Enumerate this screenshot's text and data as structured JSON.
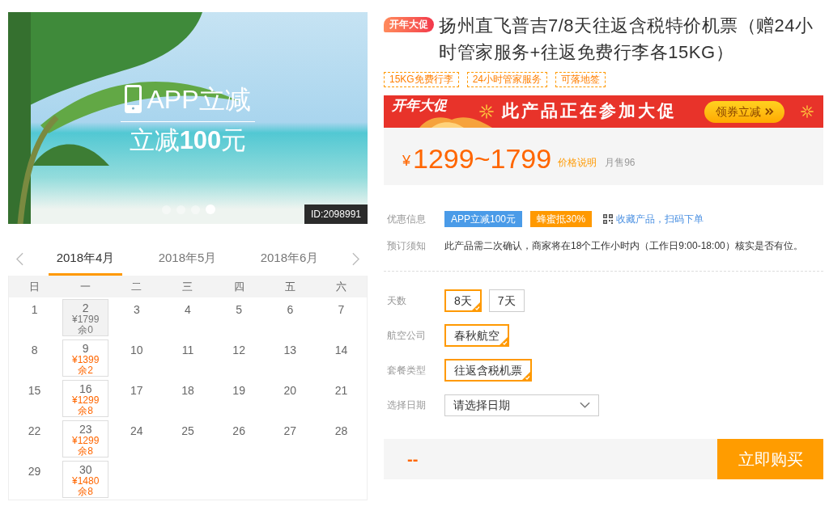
{
  "gallery": {
    "overlay": {
      "title": "APP立减",
      "subtitle": "立减**100**元"
    },
    "slides": [
      {
        "selected": false
      },
      {
        "selected": false
      },
      {
        "selected": false
      },
      {
        "selected": true
      }
    ],
    "id_badge": "ID:2098991"
  },
  "calendar": {
    "months": [
      {
        "label": "2018年4月",
        "selected": true
      },
      {
        "label": "2018年5月",
        "selected": false
      },
      {
        "label": "2018年6月",
        "selected": false
      }
    ],
    "weekdays": [
      "日",
      "一",
      "二",
      "三",
      "四",
      "五",
      "六"
    ],
    "weeks": [
      {
        "days": [
          {
            "kind": "plain",
            "day": "1"
          },
          {
            "kind": "priced",
            "day": "2",
            "price": "¥1799",
            "stock": "余0",
            "available": false
          },
          {
            "kind": "plain",
            "day": "3"
          },
          {
            "kind": "plain",
            "day": "4"
          },
          {
            "kind": "plain",
            "day": "5"
          },
          {
            "kind": "plain",
            "day": "6"
          },
          {
            "kind": "plain",
            "day": "7"
          }
        ]
      },
      {
        "days": [
          {
            "kind": "plain",
            "day": "8"
          },
          {
            "kind": "priced",
            "day": "9",
            "price": "¥1399",
            "stock": "余2",
            "available": true
          },
          {
            "kind": "plain",
            "day": "10"
          },
          {
            "kind": "plain",
            "day": "11"
          },
          {
            "kind": "plain",
            "day": "12"
          },
          {
            "kind": "plain",
            "day": "13"
          },
          {
            "kind": "plain",
            "day": "14"
          }
        ]
      },
      {
        "days": [
          {
            "kind": "plain",
            "day": "15"
          },
          {
            "kind": "priced",
            "day": "16",
            "price": "¥1299",
            "stock": "余8",
            "available": true
          },
          {
            "kind": "plain",
            "day": "17"
          },
          {
            "kind": "plain",
            "day": "18"
          },
          {
            "kind": "plain",
            "day": "19"
          },
          {
            "kind": "plain",
            "day": "20"
          },
          {
            "kind": "plain",
            "day": "21"
          }
        ]
      },
      {
        "days": [
          {
            "kind": "plain",
            "day": "22"
          },
          {
            "kind": "priced",
            "day": "23",
            "price": "¥1299",
            "stock": "余8",
            "available": true
          },
          {
            "kind": "plain",
            "day": "24"
          },
          {
            "kind": "plain",
            "day": "25"
          },
          {
            "kind": "plain",
            "day": "26"
          },
          {
            "kind": "plain",
            "day": "27"
          },
          {
            "kind": "plain",
            "day": "28"
          }
        ]
      },
      {
        "days": [
          {
            "kind": "plain",
            "day": "29"
          },
          {
            "kind": "priced",
            "day": "30",
            "price": "¥1480",
            "stock": "余8",
            "available": true
          }
        ]
      }
    ]
  },
  "product": {
    "badge": "开年大促",
    "title": "扬州直飞普吉7/8天往返含税特价机票（赠24小时管家服务+往返免费行李各15KG）",
    "tags": [
      "15KG免费行李",
      "24小时管家服务",
      "可落地签"
    ]
  },
  "promo_banner": {
    "badge": "开年大促",
    "text": "此产品正在参加大促",
    "button": "领券立减"
  },
  "price": {
    "currency": "¥",
    "range": "1299~1799",
    "note_link": "价格说明",
    "sales": "月售96"
  },
  "offers": {
    "label": "优惠信息",
    "badges": [
      {
        "text": "APP立减100元",
        "color": "#4a9be8"
      },
      {
        "text": "蜂蜜抵30%",
        "color": "#ff9900"
      }
    ],
    "link": "收藏产品，扫码下单"
  },
  "booking_notice": {
    "label": "预订须知",
    "text": "此产品需二次确认，商家将在18个工作小时内（工作日9:00-18:00）核实是否有位。"
  },
  "options": [
    {
      "label": "天数",
      "kind": "choices",
      "choices": [
        {
          "text": "8天",
          "selected": true
        },
        {
          "text": "7天",
          "selected": false
        }
      ]
    },
    {
      "label": "航空公司",
      "kind": "choices",
      "choices": [
        {
          "text": "春秋航空",
          "selected": true
        }
      ]
    },
    {
      "label": "套餐类型",
      "kind": "choices",
      "choices": [
        {
          "text": "往返含税机票",
          "selected": true
        }
      ]
    },
    {
      "label": "选择日期",
      "kind": "select",
      "value": "请选择日期"
    }
  ],
  "footer": {
    "total": "--",
    "buy_button": "立即购买"
  }
}
